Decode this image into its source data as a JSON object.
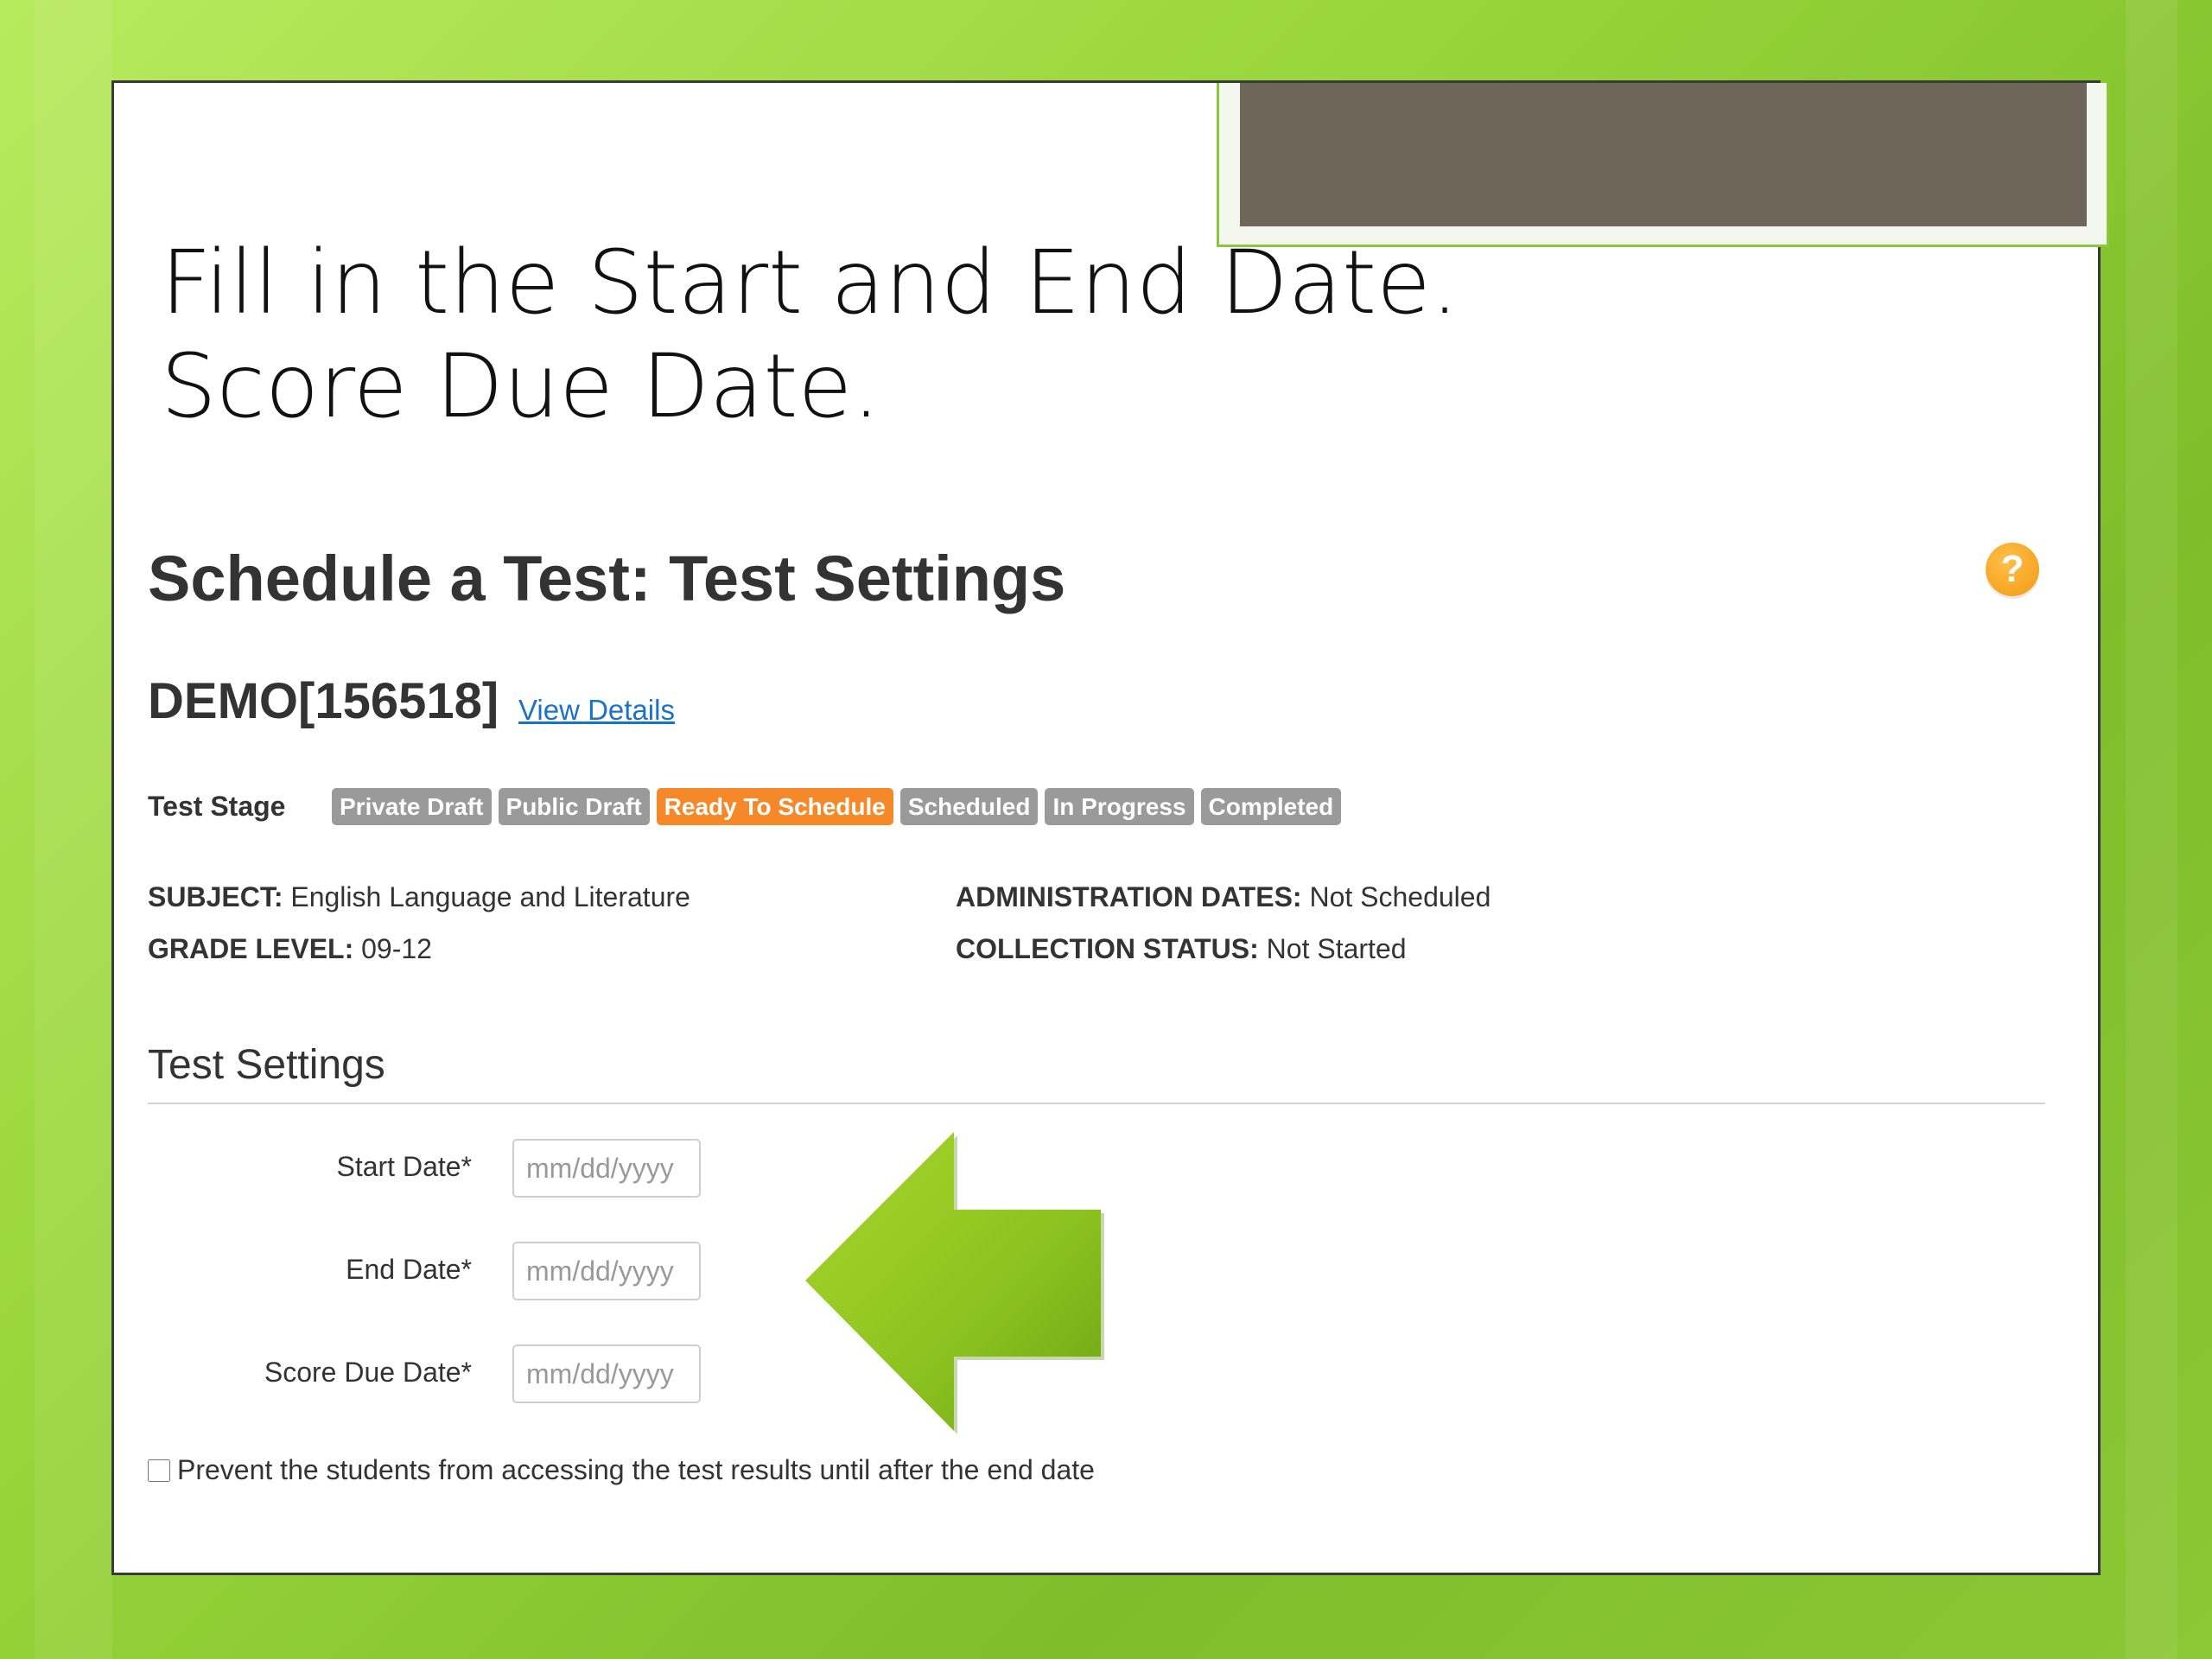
{
  "slide": {
    "instruction_line1": "Fill in the Start and End Date.",
    "instruction_line2": "Score Due Date."
  },
  "page": {
    "title": "Schedule a Test: Test Settings",
    "help_icon": "?",
    "test_name": "DEMO[156518]",
    "view_details": "View Details"
  },
  "test_stage": {
    "label": "Test Stage",
    "stages": [
      "Private Draft",
      "Public Draft",
      "Ready To Schedule",
      "Scheduled",
      "In Progress",
      "Completed"
    ],
    "active_stage": "Ready To Schedule"
  },
  "details": {
    "subject_label": "SUBJECT:",
    "subject_value": "English Language and Literature",
    "grade_label": "GRADE LEVEL:",
    "grade_value": "09-12",
    "admin_label": "ADMINISTRATION DATES:",
    "admin_value": "Not Scheduled",
    "collection_label": "COLLECTION STATUS:",
    "collection_value": "Not Started"
  },
  "settings": {
    "section_title": "Test Settings",
    "start_date_label": "Start Date*",
    "end_date_label": "End Date*",
    "score_due_label": "Score Due Date*",
    "date_placeholder": "mm/dd/yyyy",
    "prevent_checkbox_label": "Prevent the students from accessing the test results until after the end date",
    "prevent_checked": false
  },
  "colors": {
    "background_green": "#9ad63d",
    "title_panel": "#6e6759",
    "active_stage": "#f5892a",
    "inactive_stage": "#9a9a9a",
    "link": "#1a73c9",
    "arrow": "#8cc63f"
  }
}
